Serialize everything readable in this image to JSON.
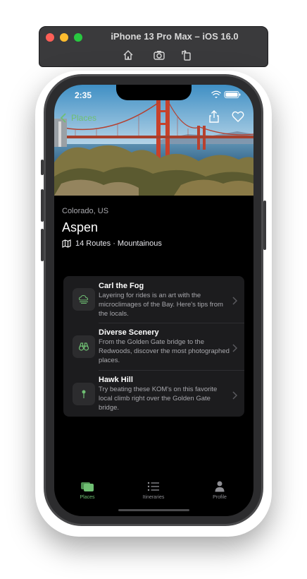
{
  "window": {
    "title": "iPhone 13 Pro Max – iOS 16.0",
    "tools": [
      "home-icon",
      "screenshot-icon",
      "rotate-icon"
    ]
  },
  "status_bar": {
    "time": "2:35"
  },
  "nav": {
    "back_label": "Places"
  },
  "place": {
    "region": "Colorado, US",
    "name": "Aspen",
    "meta": "14 Routes · Mountainous"
  },
  "items": [
    {
      "icon": "fog-icon",
      "title": "Carl the Fog",
      "desc": "Layering for rides is an art with the microclimages of the Bay. Here's tips from the locals."
    },
    {
      "icon": "binoculars-icon",
      "title": "Diverse Scenery",
      "desc": "From the Golden Gate bridge to the Redwoods, discover the most photographed places."
    },
    {
      "icon": "pin-icon",
      "title": "Hawk Hill",
      "desc": "Try beating these KOM's on this favorite local climb right over the Golden Gate bridge."
    }
  ],
  "tabs": [
    {
      "label": "Places",
      "icon": "places-icon",
      "selected": true
    },
    {
      "label": "Itineraries",
      "icon": "list-icon",
      "selected": false
    },
    {
      "label": "Profile",
      "icon": "person-icon",
      "selected": false
    }
  ],
  "colors": {
    "accent": "#6fbf73",
    "inactive_tab": "#8e8e93",
    "card_bg": "#1c1c1e",
    "screen_bg": "#000000"
  }
}
